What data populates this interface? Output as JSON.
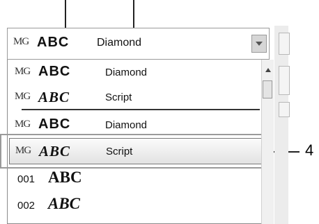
{
  "combo": {
    "logo": "MG",
    "sample": "ABC",
    "font_name": "Diamond",
    "dropdown_icon": "chevron-down-icon"
  },
  "list": {
    "rows": [
      {
        "logo": "MG",
        "sample": "ABC",
        "name": "Diamond"
      },
      {
        "logo": "MG",
        "sample": "ABC",
        "name": "Script"
      },
      {
        "logo": "MG",
        "sample": "ABC",
        "name": "Diamond"
      },
      {
        "logo": "MG",
        "sample": "ABC",
        "name": "Script"
      },
      {
        "num": "001",
        "sample": "ABC"
      },
      {
        "num": "002",
        "sample": "ABC"
      }
    ],
    "selected_index": 3
  },
  "callouts": {
    "label_4": "4"
  }
}
